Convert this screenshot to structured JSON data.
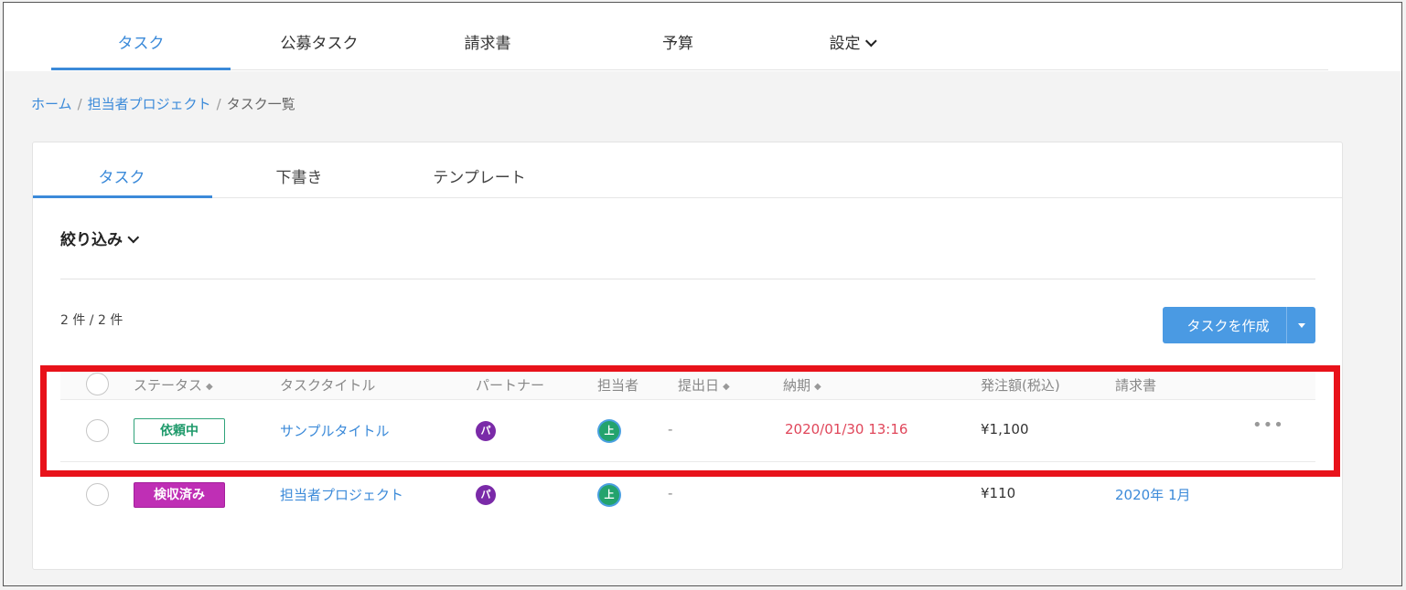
{
  "topnav": {
    "tabs": [
      {
        "label": "タスク",
        "active": true
      },
      {
        "label": "公募タスク",
        "active": false
      },
      {
        "label": "請求書",
        "active": false
      },
      {
        "label": "予算",
        "active": false
      },
      {
        "label": "設定",
        "active": false,
        "dropdown": true
      }
    ]
  },
  "breadcrumb": {
    "items": [
      "ホーム",
      "担当者プロジェクト",
      "タスク一覧"
    ],
    "separator": "/"
  },
  "subtabs": [
    {
      "label": "タスク",
      "active": true
    },
    {
      "label": "下書き",
      "active": false
    },
    {
      "label": "テンプレート",
      "active": false
    }
  ],
  "filter": {
    "label": "絞り込み"
  },
  "count": {
    "text": "2 件 / 2 件"
  },
  "create_button": {
    "label": "タスクを作成",
    "color": "#4a9ae3"
  },
  "table": {
    "columns": [
      "ステータス",
      "タスクタイトル",
      "パートナー",
      "担当者",
      "提出日",
      "納期",
      "発注額(税込)",
      "請求書"
    ],
    "sortable": {
      "ステータス": true,
      "提出日": true,
      "納期": true
    },
    "rows": [
      {
        "status": "依頼中",
        "status_color": "#1f9a6b",
        "title": "サンプルタイトル",
        "partner_avatar": "パ",
        "assignee_avatar": "上",
        "submitted": "-",
        "deadline": "2020/01/30 13:16",
        "amount": "¥1,100",
        "invoice": "",
        "more": "•••"
      },
      {
        "status": "検収済み",
        "status_color": "#bf2fb5",
        "title": "担当者プロジェクト",
        "partner_avatar": "パ",
        "assignee_avatar": "上",
        "submitted": "-",
        "deadline": "",
        "amount": "¥110",
        "invoice": "2020年 1月"
      }
    ]
  },
  "colors": {
    "accent": "#3b8ad9",
    "highlight": "#e8121a",
    "deadline_overdue": "#e0465a"
  }
}
